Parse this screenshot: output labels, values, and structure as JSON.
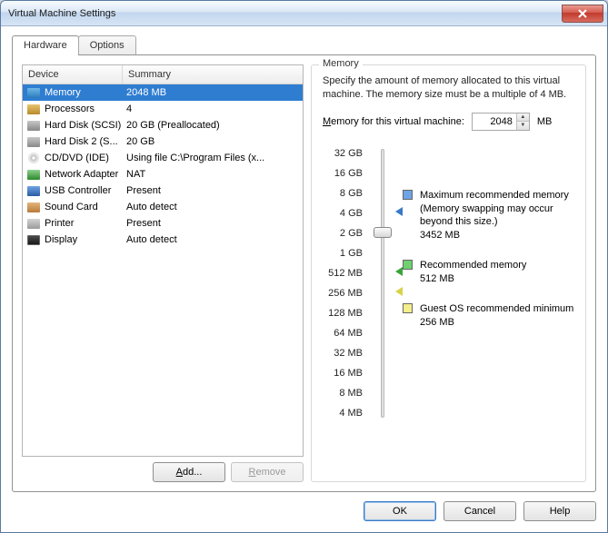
{
  "window": {
    "title": "Virtual Machine Settings"
  },
  "tabs": {
    "hardware": "Hardware",
    "options": "Options"
  },
  "table": {
    "headers": {
      "device": "Device",
      "summary": "Summary"
    },
    "rows": [
      {
        "icon": "memory-icon",
        "name": "Memory",
        "summary": "2048 MB",
        "selected": true
      },
      {
        "icon": "cpu-icon",
        "name": "Processors",
        "summary": "4"
      },
      {
        "icon": "hdd-icon",
        "name": "Hard Disk (SCSI)",
        "summary": "20 GB (Preallocated)"
      },
      {
        "icon": "hdd-icon",
        "name": "Hard Disk 2 (S...",
        "summary": "20 GB"
      },
      {
        "icon": "cd-icon",
        "name": "CD/DVD (IDE)",
        "summary": "Using file C:\\Program Files (x..."
      },
      {
        "icon": "network-icon",
        "name": "Network Adapter",
        "summary": "NAT"
      },
      {
        "icon": "usb-icon",
        "name": "USB Controller",
        "summary": "Present"
      },
      {
        "icon": "sound-icon",
        "name": "Sound Card",
        "summary": "Auto detect"
      },
      {
        "icon": "printer-icon",
        "name": "Printer",
        "summary": "Present"
      },
      {
        "icon": "display-icon",
        "name": "Display",
        "summary": "Auto detect"
      }
    ]
  },
  "buttons": {
    "add": "Add...",
    "remove": "Remove",
    "ok": "OK",
    "cancel": "Cancel",
    "help": "Help"
  },
  "memory": {
    "legend": "Memory",
    "description": "Specify the amount of memory allocated to this virtual machine. The memory size must be a multiple of 4 MB.",
    "field_label": "Memory for this virtual machine:",
    "value": "2048",
    "unit": "MB",
    "ticks": [
      "32 GB",
      "16 GB",
      "8 GB",
      "4 GB",
      "2 GB",
      "1 GB",
      "512 MB",
      "256 MB",
      "128 MB",
      "64 MB",
      "32 MB",
      "16 MB",
      "8 MB",
      "4 MB"
    ],
    "max_rec": {
      "label": "Maximum recommended memory",
      "note": "(Memory swapping may occur beyond this size.)",
      "value": "3452 MB"
    },
    "rec": {
      "label": "Recommended memory",
      "value": "512 MB"
    },
    "min": {
      "label": "Guest OS recommended minimum",
      "value": "256 MB"
    }
  }
}
